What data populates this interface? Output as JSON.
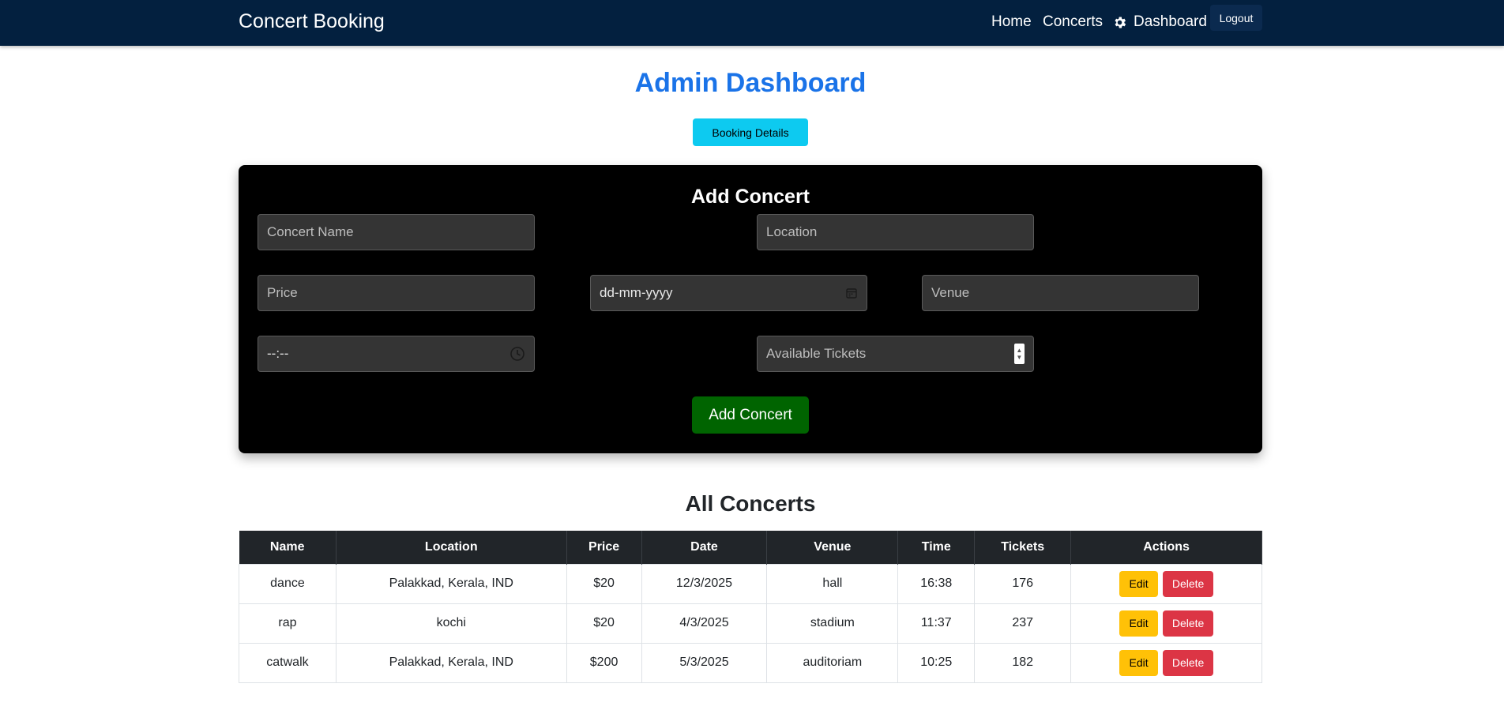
{
  "navbar": {
    "brand": "Concert Booking",
    "links": {
      "home": "Home",
      "concerts": "Concerts",
      "dashboard": "Dashboard"
    },
    "logout_label": "Logout"
  },
  "page": {
    "title": "Admin Dashboard",
    "booking_details_label": "Booking Details"
  },
  "form": {
    "title": "Add Concert",
    "name_placeholder": "Concert Name",
    "location_placeholder": "Location",
    "price_placeholder": "Price",
    "date_placeholder": "dd-mm-yyyy",
    "venue_placeholder": "Venue",
    "time_placeholder": "--:--",
    "tickets_placeholder": "Available Tickets",
    "submit_label": "Add Concert"
  },
  "table": {
    "title": "All Concerts",
    "headers": [
      "Name",
      "Location",
      "Price",
      "Date",
      "Venue",
      "Time",
      "Tickets",
      "Actions"
    ],
    "edit_label": "Edit",
    "delete_label": "Delete",
    "rows": [
      {
        "name": "dance",
        "location": "Palakkad, Kerala, IND",
        "price": "$20",
        "date": "12/3/2025",
        "venue": "hall",
        "time": "16:38",
        "tickets": "176"
      },
      {
        "name": "rap",
        "location": "kochi",
        "price": "$20",
        "date": "4/3/2025",
        "venue": "stadium",
        "time": "11:37",
        "tickets": "237"
      },
      {
        "name": "catwalk",
        "location": "Palakkad, Kerala, IND",
        "price": "$200",
        "date": "5/3/2025",
        "venue": "auditoriam",
        "time": "10:25",
        "tickets": "182"
      }
    ]
  },
  "colors": {
    "navbar": "#03203f",
    "title": "#1a73e8",
    "info_button": "#0dcaf0",
    "add_button": "#006400",
    "edit_button": "#ffc107",
    "delete_button": "#dc3545"
  },
  "icons": [
    "gear-icon",
    "calendar-icon",
    "clock-icon",
    "spinner-icon"
  ]
}
